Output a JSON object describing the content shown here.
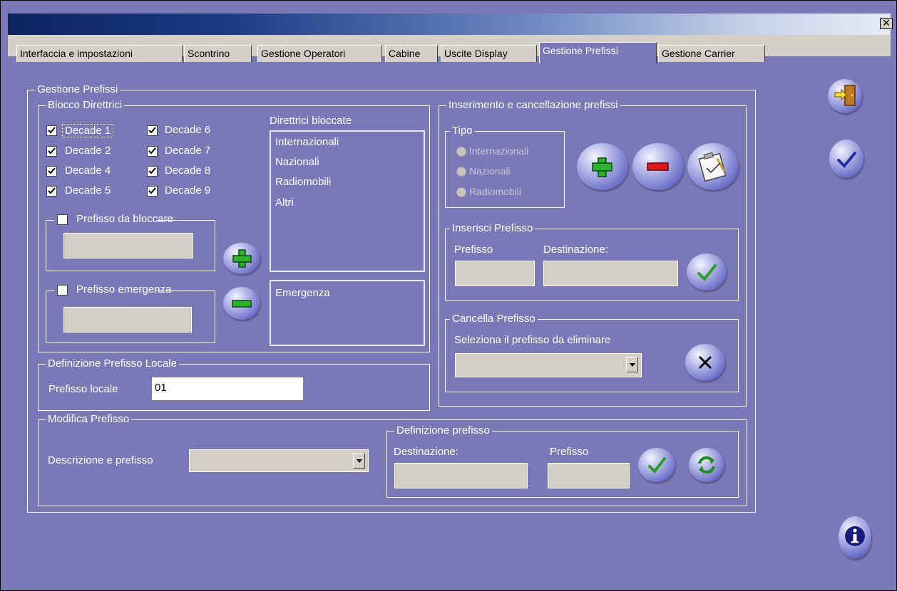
{
  "window": {
    "close_glyph": "✕"
  },
  "tabs": [
    {
      "label": "Interfaccia  e impostazioni"
    },
    {
      "label": "Scontrino"
    },
    {
      "label": "Gestione Operatori"
    },
    {
      "label": "Cabine"
    },
    {
      "label": "Uscite Display"
    },
    {
      "label": "Gestione Prefissi"
    },
    {
      "label": "Gestione Carrier"
    }
  ],
  "main": {
    "group_title": "Gestione Prefissi",
    "blocco": {
      "title": "Blocco Direttrici",
      "decades": [
        {
          "label": "Decade 1",
          "checked": true
        },
        {
          "label": "Decade 2",
          "checked": true
        },
        {
          "label": "Decade 4",
          "checked": true
        },
        {
          "label": "Decade 5",
          "checked": true
        },
        {
          "label": "Decade 6",
          "checked": true
        },
        {
          "label": "Decade 7",
          "checked": true
        },
        {
          "label": "Decade 8",
          "checked": true
        },
        {
          "label": "Decade 9",
          "checked": true
        }
      ],
      "direttrici_label": "Direttrici bloccate",
      "direttrici_items": [
        "Internazionali",
        "Nazionali",
        "Radiomobili",
        "Altri"
      ],
      "prefisso_bloccare_label": "Prefisso da bloccare",
      "prefisso_emergenza_label": "Prefisso emergenza",
      "emergenza_items": [
        "Emergenza"
      ]
    },
    "locale": {
      "title": "Definizione Prefisso Locale",
      "label": "Prefisso locale",
      "value": "01"
    },
    "modifica": {
      "title": "Modifica Prefisso",
      "descr_label": "Descrizione e prefisso",
      "definizione": {
        "title": "Definizione prefisso",
        "destinazione_label": "Destinazione:",
        "prefisso_label": "Prefisso"
      }
    },
    "inserimento": {
      "title": "Inserimento e cancellazione prefissi",
      "tipo": {
        "title": "Tipo",
        "options": [
          "Internazionali",
          "Nazionali",
          "Radiomobili"
        ]
      },
      "inserisci": {
        "title": "Inserisci Prefisso",
        "prefisso_label": "Prefisso",
        "destinazione_label": "Destinazione:"
      },
      "cancella": {
        "title": "Cancella Prefisso",
        "seleziona_label": "Seleziona il prefisso da eliminare"
      }
    }
  }
}
